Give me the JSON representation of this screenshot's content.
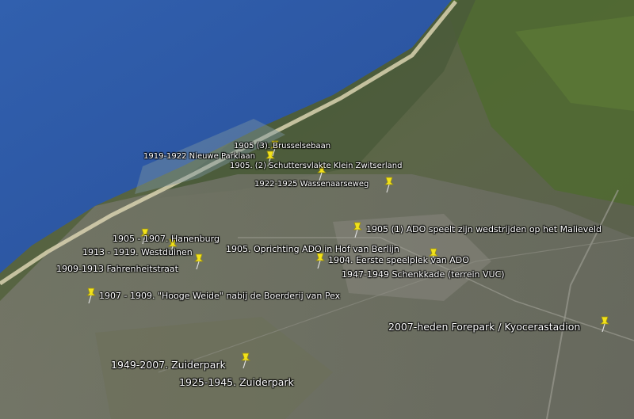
{
  "places": [
    {
      "id": "brusselsebaan",
      "label": "1905 (3). Brusselsebaan"
    },
    {
      "id": "nieuwe-parklaan",
      "label": "1919-1922 Nieuwe Parklaan"
    },
    {
      "id": "klein-zwitserland",
      "label": "1905. (2) Schuttersvlakte Klein Zwitserland"
    },
    {
      "id": "wassenaarseweg",
      "label": "1922-1925 Wassenaarseweg"
    },
    {
      "id": "malieveld",
      "label": "1905 (1) ADO speelt zijn wedstrijden op het Malieveld"
    },
    {
      "id": "hanenburg",
      "label": "1905 - 1907. Hanenburg"
    },
    {
      "id": "westduinen",
      "label": "1913 - 1919.  Westduinen"
    },
    {
      "id": "hof-van-berlijn",
      "label": "1905. Oprichting ADO in Hof van Berlijn"
    },
    {
      "id": "eerste-speelplek",
      "label": "1904. Eerste speelplek van ADO"
    },
    {
      "id": "fahrenheitstraat",
      "label": "1909-1913 Fahrenheitstraat"
    },
    {
      "id": "schenkkade",
      "label": "1947-1949 Schenkkade (terrein VUC)"
    },
    {
      "id": "hooge-weide",
      "label": "1907 - 1909. \"Hooge Weide\" nabij de Boerderij van Pex"
    },
    {
      "id": "forepark",
      "label": "2007-heden Forepark / Kyocerastadion"
    },
    {
      "id": "zuiderpark-2007",
      "label": "1949-2007. Zuiderpark"
    },
    {
      "id": "zuiderpark-1945",
      "label": "1925-1945. Zuiderpark"
    }
  ],
  "colors": {
    "pin": "#f2e21a",
    "label": "#ffffff",
    "sea": "#2b57a8",
    "land": "#5a6a40"
  },
  "icons": {
    "marker": "pushpin-icon"
  }
}
